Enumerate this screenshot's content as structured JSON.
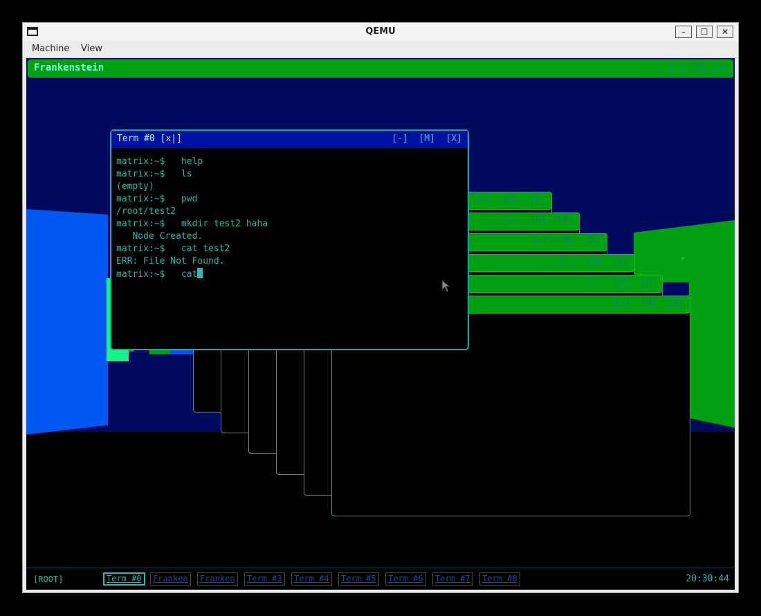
{
  "host": {
    "title": "QEMU",
    "menu": [
      "Machine",
      "View"
    ],
    "buttons": {
      "minimize": "–",
      "maximize": "☐",
      "close": "✕"
    }
  },
  "desktop": {
    "top_window_title": "Frankenstein",
    "window_controls": "[-]  [M]  [X]"
  },
  "terminal": {
    "title": "Term #0 [x|]",
    "controls": "[-]  [M]  [X]",
    "lines": [
      "matrix:~$   help",
      "matrix:~$   ls",
      "(empty)",
      "matrix:~$   pwd",
      "/root/test2",
      "matrix:~$   mkdir test2 haha",
      "   Node Created.",
      "matrix:~$   cat test2",
      "ERR: File Not Found.",
      "matrix:~$   cat"
    ]
  },
  "taskbar": {
    "root_label": "[ROOT]",
    "tasks": [
      "Term #0",
      "Franken",
      "Franken",
      "Term #3",
      "Term #4",
      "Term #5",
      "Term #6",
      "Term #7",
      "Term #8"
    ],
    "active_index": 0,
    "clock": "20:30:44"
  },
  "colors": {
    "sky": "#000a5c",
    "green": "#00a012",
    "cyan": "#2ab8a8",
    "blue_wall": "#0058f0",
    "term_bar": "#0010a0"
  }
}
